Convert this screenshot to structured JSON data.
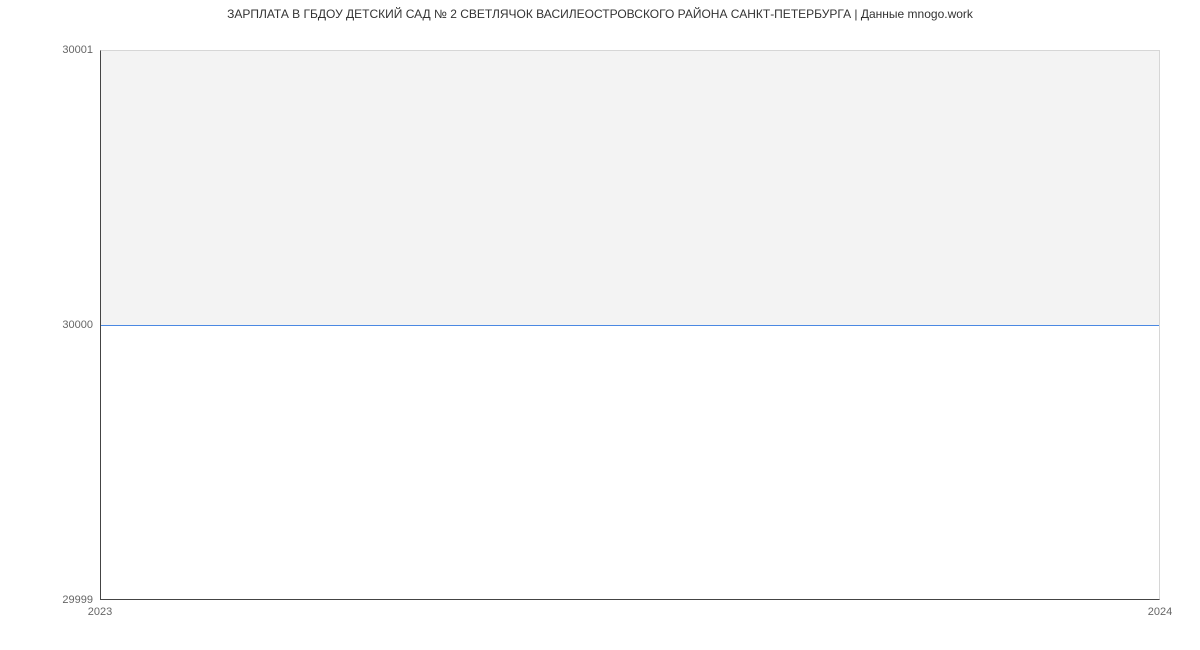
{
  "chart_data": {
    "type": "line",
    "title": "ЗАРПЛАТА В ГБДОУ ДЕТСКИЙ САД № 2 СВЕТЛЯЧОК ВАСИЛЕОСТРОВСКОГО РАЙОНА САНКТ-ПЕТЕРБУРГА | Данные mnogo.work",
    "xlabel": "",
    "ylabel": "",
    "x": [
      "2023",
      "2024"
    ],
    "values": [
      30000,
      30000
    ],
    "xlim": [
      "2023",
      "2024"
    ],
    "ylim": [
      29999,
      30001
    ],
    "y_ticks": [
      29999,
      30000,
      30001
    ],
    "x_ticks": [
      "2023",
      "2024"
    ],
    "line_color": "#4a88e2",
    "plot_bg": "#f3f3f3"
  }
}
